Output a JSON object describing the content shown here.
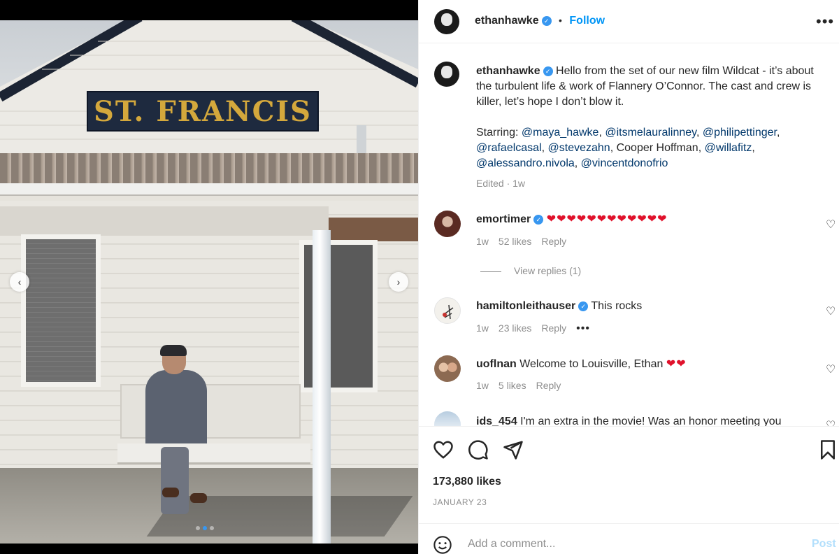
{
  "post": {
    "author": "ethanhawke",
    "follow_label": "Follow",
    "separator": "•",
    "more_label": "•••",
    "sign_text": "ST. FRANCIS",
    "carousel_prev": "‹",
    "carousel_next": "›",
    "carousel_index": 2,
    "carousel_total": 3
  },
  "caption": {
    "username": "ethanhawke",
    "text": "Hello from the set of our new film Wildcat - it’s about the turbulent life & work of Flannery O’Connor. The cast and crew is killer, let’s hope I don’t blow it.",
    "starring_label": "Starring:",
    "mentions": [
      "@maya_hawke",
      "@itsmelauralinney",
      "@philipettinger",
      "@rafaelcasal",
      "@stevezahn",
      "@willafitz",
      "@alessandro.nivola",
      "@vincentdonofrio"
    ],
    "plain_name": "Cooper Hoffman",
    "edited": "Edited · 1w"
  },
  "comments": [
    {
      "username": "emortimer",
      "verified": true,
      "text": "❤❤❤❤❤❤❤❤❤❤❤❤",
      "time": "1w",
      "likes": "52 likes",
      "reply": "Reply"
    },
    {
      "username": "hamiltonleithauser",
      "verified": true,
      "text": "This rocks",
      "time": "1w",
      "likes": "23 likes",
      "reply": "Reply",
      "more": "•••"
    },
    {
      "username": "uoflnan",
      "verified": false,
      "text": "Welcome to Louisville, Ethan",
      "hearts": "❤❤",
      "time": "1w",
      "likes": "5 likes",
      "reply": "Reply"
    },
    {
      "username": "ids_454",
      "verified": false,
      "text": "I'm an extra in the movie! Was an honor meeting you"
    }
  ],
  "view_replies": "View replies (1)",
  "likes_total": "173,880 likes",
  "date": "JANUARY 23",
  "comment_box": {
    "placeholder": "Add a comment...",
    "post_label": "Post"
  },
  "colors": {
    "accent": "#0095f6",
    "link": "#00376b",
    "muted": "#8e8e8e",
    "heart": "#e0112b",
    "post_disabled": "#b2dffc"
  }
}
